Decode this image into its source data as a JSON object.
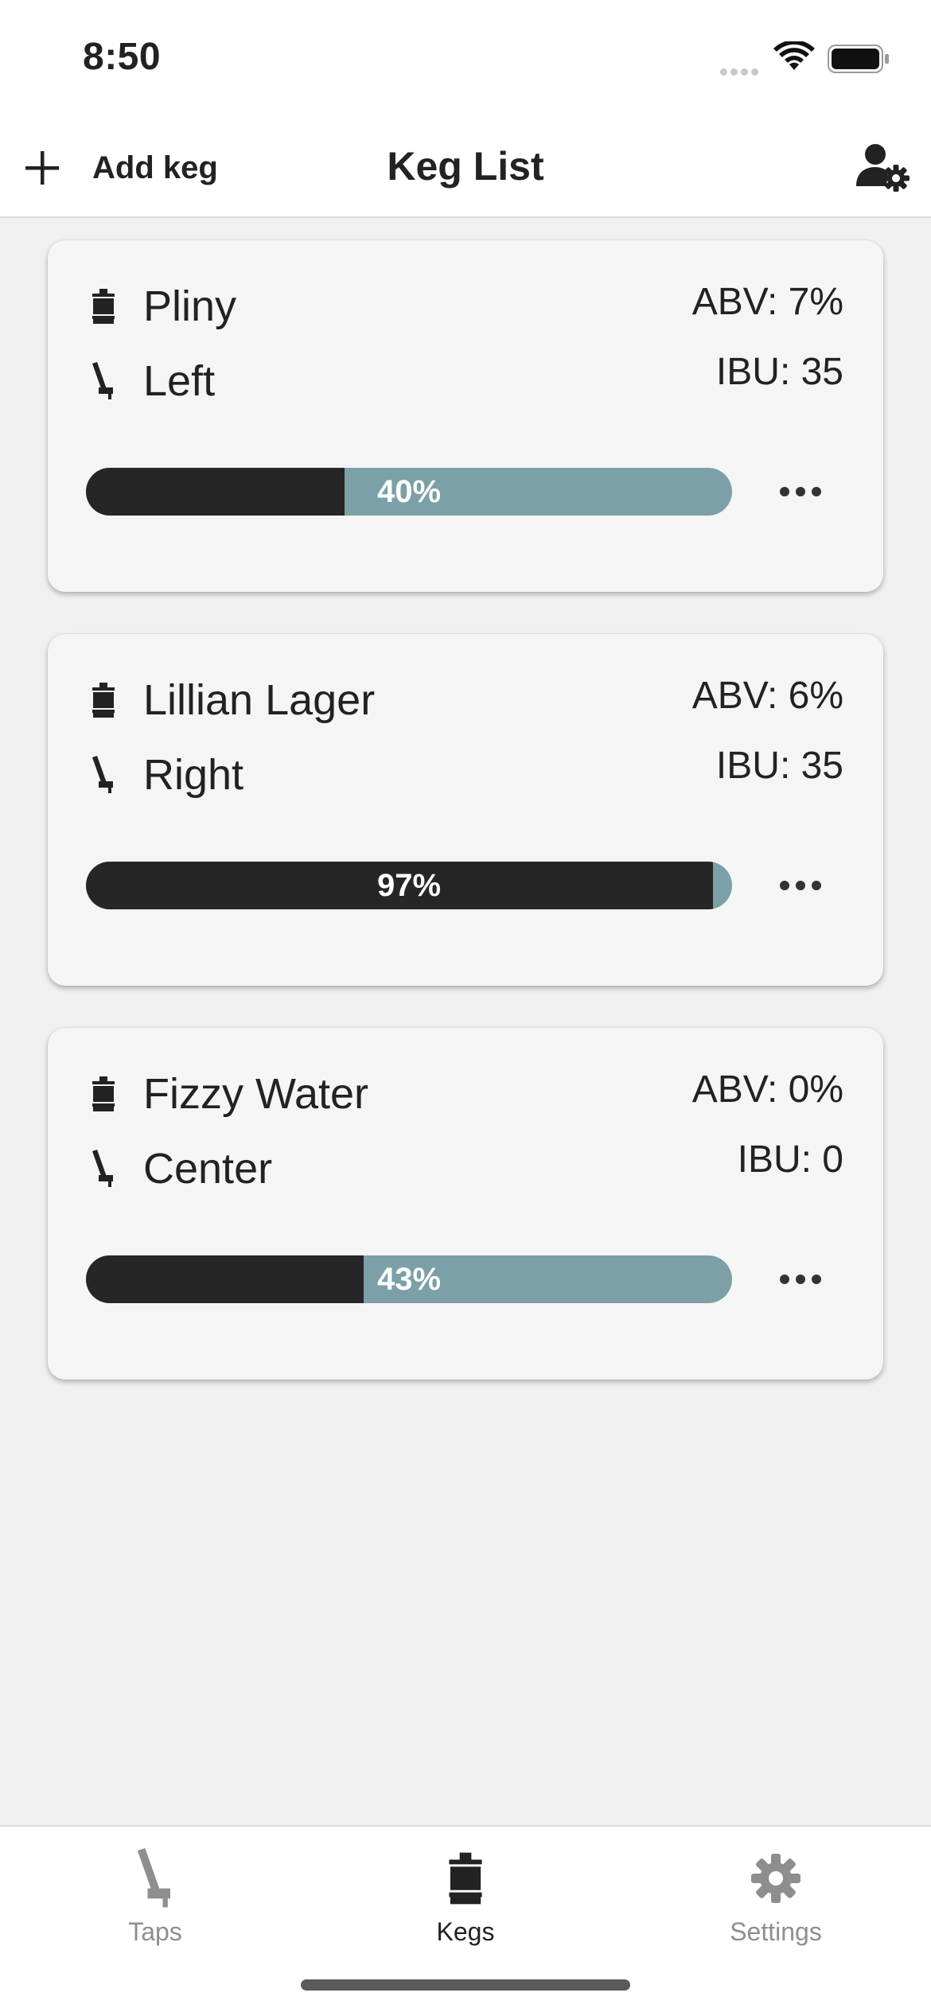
{
  "status_bar": {
    "time": "8:50"
  },
  "header": {
    "add_label": "Add keg",
    "title": "Keg List"
  },
  "kegs": [
    {
      "name": "Pliny",
      "tap": "Left",
      "abv": "ABV: 7%",
      "ibu": "IBU: 35",
      "fill_label": "40%",
      "fill_fraction": 0.4
    },
    {
      "name": "Lillian Lager",
      "tap": "Right",
      "abv": "ABV: 6%",
      "ibu": "IBU: 35",
      "fill_label": "97%",
      "fill_fraction": 0.97
    },
    {
      "name": "Fizzy Water",
      "tap": "Center",
      "abv": "ABV: 0%",
      "ibu": "IBU: 0",
      "fill_label": "43%",
      "fill_fraction": 0.43
    }
  ],
  "nav": {
    "items": [
      {
        "label": "Taps",
        "icon": "tap-handle-icon",
        "active": false
      },
      {
        "label": "Kegs",
        "icon": "keg-icon",
        "active": true
      },
      {
        "label": "Settings",
        "icon": "gear-icon",
        "active": false
      }
    ]
  },
  "colors": {
    "fill_dark": "#262626",
    "fill_remaining": "#7ba0a7",
    "nav_active": "#222222",
    "nav_inactive": "#8e8e8e"
  }
}
